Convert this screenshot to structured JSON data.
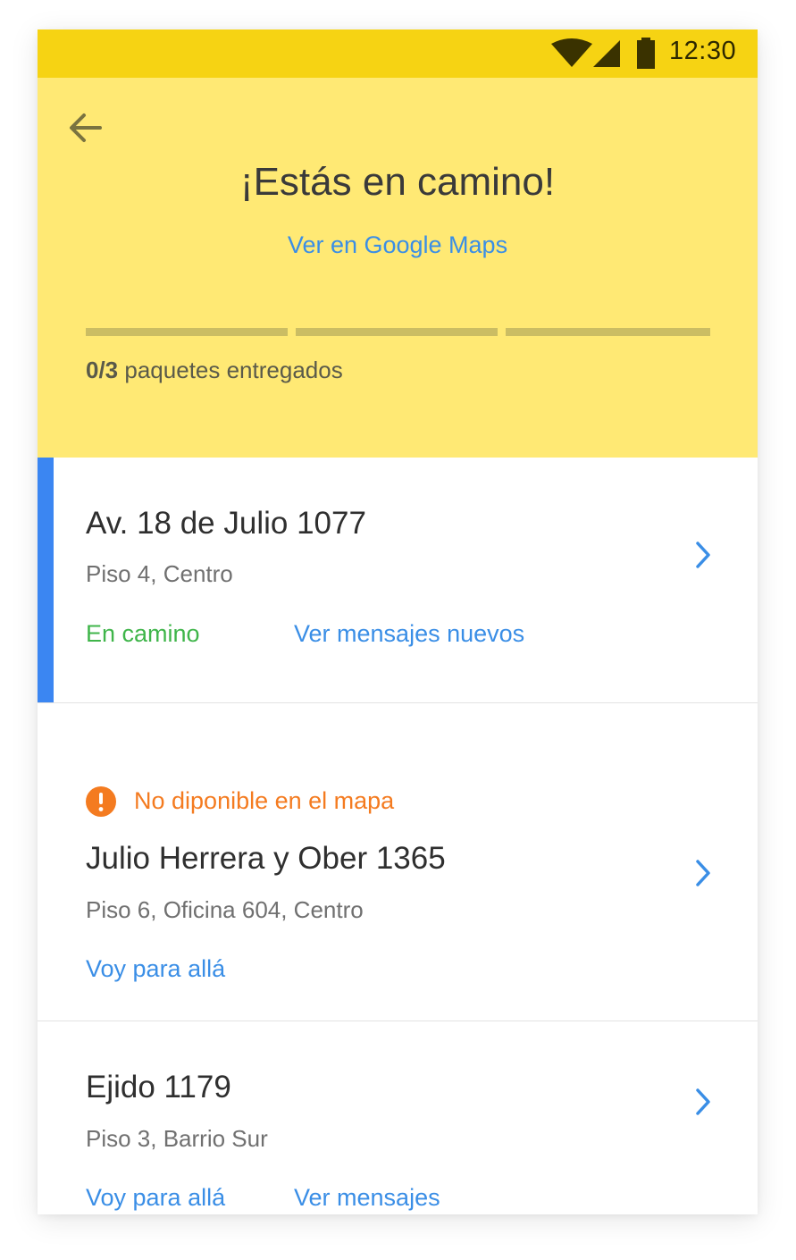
{
  "status_bar": {
    "time": "12:30",
    "icons": [
      "wifi-icon",
      "cell-signal-icon",
      "battery-icon"
    ]
  },
  "header": {
    "title": "¡Estás en camino!",
    "maps_link": "Ver en Google Maps",
    "progress_delivered": "0/3",
    "progress_suffix": "paquetes entregados",
    "progress_fraction": 0
  },
  "deliveries": [
    {
      "address": "Av. 18 de Julio 1077",
      "detail": "Piso 4, Centro",
      "status": "En camino",
      "action": "Ver mensajes nuevos"
    },
    {
      "warning": "No diponible en el mapa",
      "address": "Julio Herrera y Ober 1365",
      "detail": "Piso 6, Oficina 604, Centro",
      "action": "Voy para allá"
    },
    {
      "address": "Ejido 1179",
      "detail": "Piso 3, Barrio Sur",
      "action": "Voy para allá",
      "action2": "Ver mensajes"
    }
  ],
  "colors": {
    "status_bar": "#f6d313",
    "header": "#ffe974",
    "accent_blue": "#3a8ee6",
    "active_bar": "#3b86f2",
    "status_green": "#3fb54a",
    "warning_orange": "#f47b20"
  }
}
